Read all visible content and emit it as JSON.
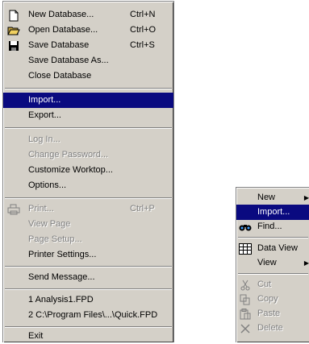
{
  "file_menu": {
    "items": [
      {
        "label": "New Database...",
        "shortcut": "Ctrl+N",
        "icon": "new-document-icon"
      },
      {
        "label": "Open Database...",
        "shortcut": "Ctrl+O",
        "icon": "open-folder-icon"
      },
      {
        "label": "Save Database",
        "shortcut": "Ctrl+S",
        "icon": "save-disk-icon"
      },
      {
        "label": "Save Database As..."
      },
      {
        "label": "Close Database"
      },
      {
        "label": "Import..."
      },
      {
        "label": "Export..."
      },
      {
        "label": "Log In..."
      },
      {
        "label": "Change Password..."
      },
      {
        "label": "Customize Worktop..."
      },
      {
        "label": "Options..."
      },
      {
        "label": "Print...",
        "shortcut": "Ctrl+P",
        "icon": "printer-icon"
      },
      {
        "label": "View Page"
      },
      {
        "label": "Page Setup..."
      },
      {
        "label": "Printer Settings..."
      },
      {
        "label": "Send Message..."
      },
      {
        "label": "1 Analysis1.FPD"
      },
      {
        "label": "2 C:\\Program Files\\...\\Quick.FPD"
      },
      {
        "label": "Exit"
      }
    ]
  },
  "context_menu": {
    "items": [
      {
        "label": "New"
      },
      {
        "label": "Import..."
      },
      {
        "label": "Find...",
        "icon": "binoculars-icon"
      },
      {
        "label": "Data View",
        "icon": "table-icon"
      },
      {
        "label": "View"
      },
      {
        "label": "Cut",
        "icon": "scissors-icon"
      },
      {
        "label": "Copy",
        "icon": "copy-icon"
      },
      {
        "label": "Paste",
        "icon": "paste-icon"
      },
      {
        "label": "Delete",
        "icon": "delete-x-icon"
      }
    ]
  },
  "colors": {
    "menu_bg": "#d4d0c8",
    "highlight": "#0a0a80",
    "disabled": "#808080"
  }
}
